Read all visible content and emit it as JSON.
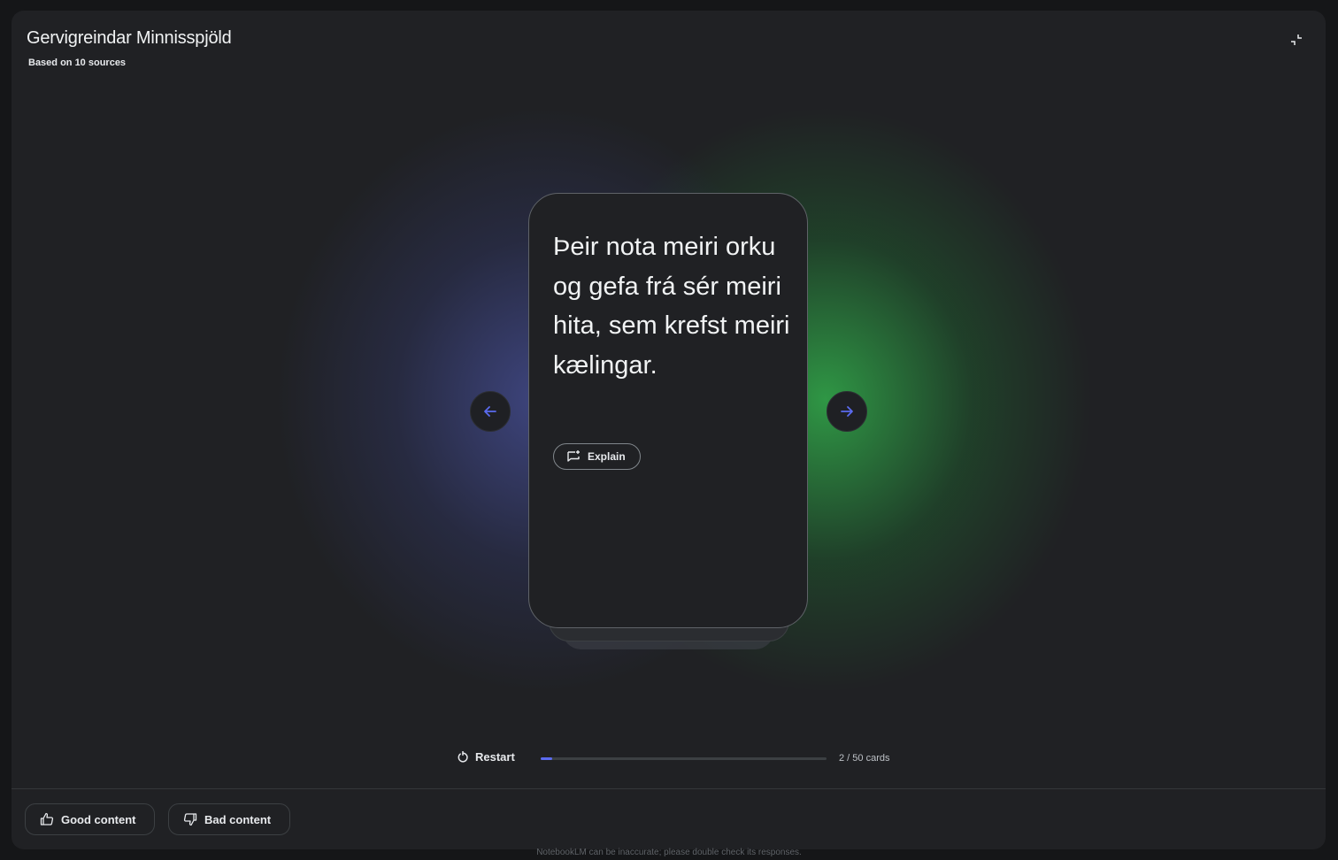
{
  "header": {
    "title": "Gervigreindar Minnisspjöld",
    "subtitle": "Based on 10 sources",
    "collapse_icon": "collapse-icon"
  },
  "card": {
    "text": "Þeir nota meiri orku og gefa frá sér meiri hita, sem krefst meiri kælingar.",
    "explain_label": "Explain",
    "explain_icon": "chat-spark-icon"
  },
  "navigation": {
    "prev_icon": "arrow-left-icon",
    "next_icon": "arrow-right-icon",
    "accent_color": "#5b6bf0"
  },
  "progress": {
    "restart_label": "Restart",
    "current": 2,
    "total": 50,
    "count_label": "2 / 50 cards"
  },
  "feedback": {
    "good_label": "Good content",
    "bad_label": "Bad content"
  },
  "footer": {
    "disclaimer": "NotebookLM can be inaccurate; please double check its responses."
  }
}
